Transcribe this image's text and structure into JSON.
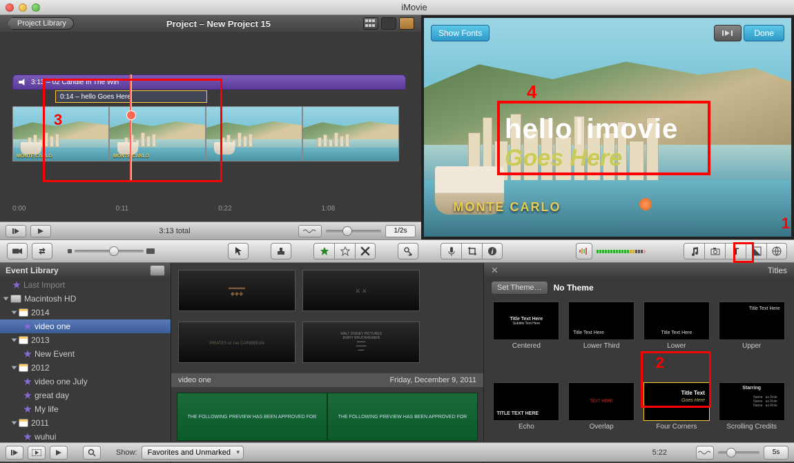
{
  "app_title": "iMovie",
  "project": {
    "back_label": "Project Library",
    "title": "Project – New Project 15",
    "audio_track_label": "3:13 – 02 Candle In The Win",
    "title_overlay": "0:14 – hello   Goes Here",
    "clip_label": "MONTE CARLO",
    "time_marks": [
      "0:00",
      "0:11",
      "0:22",
      "1:08"
    ],
    "total_label": "3:13 total",
    "zoom_label": "1/2s"
  },
  "preview": {
    "show_fonts": "Show Fonts",
    "done": "Done",
    "title_main_1": "hello",
    "title_main_2": "imovie",
    "title_sub": "Goes Here",
    "watermark": "MONTE CARLO"
  },
  "event_library": {
    "header": "Event Library",
    "items": [
      {
        "label": "Last Import",
        "indent": 1,
        "icon": "star",
        "dim": true
      },
      {
        "label": "Macintosh HD",
        "indent": 0,
        "icon": "hd",
        "disclosure": "open"
      },
      {
        "label": "2014",
        "indent": 1,
        "icon": "cal",
        "disclosure": "open"
      },
      {
        "label": "video one",
        "indent": 2,
        "icon": "star",
        "selected": true
      },
      {
        "label": "2013",
        "indent": 1,
        "icon": "cal",
        "disclosure": "open"
      },
      {
        "label": "New Event",
        "indent": 2,
        "icon": "star"
      },
      {
        "label": "2012",
        "indent": 1,
        "icon": "cal",
        "disclosure": "open"
      },
      {
        "label": "video one July",
        "indent": 2,
        "icon": "star"
      },
      {
        "label": "great day",
        "indent": 2,
        "icon": "star"
      },
      {
        "label": "My life",
        "indent": 2,
        "icon": "star"
      },
      {
        "label": "2011",
        "indent": 1,
        "icon": "cal",
        "disclosure": "open"
      },
      {
        "label": "wuhui",
        "indent": 2,
        "icon": "star"
      }
    ]
  },
  "event_browser": {
    "current_event": "video one",
    "date_label": "Friday, December 9, 2011",
    "preview_text": "THE FOLLOWING PREVIEW HAS BEEN APPROVED FOR"
  },
  "titles_panel": {
    "header": "Titles",
    "set_theme": "Set Theme…",
    "theme_name": "No Theme",
    "items": [
      {
        "label": "Centered",
        "line1": "Title Text Here",
        "line2": "Subtitle Text Here"
      },
      {
        "label": "Lower Third",
        "line1": "Title Text Here"
      },
      {
        "label": "Lower",
        "line1": "Title Text Here"
      },
      {
        "label": "Upper",
        "line1": "Title Text Here"
      },
      {
        "label": "Echo",
        "line1": "TITLE TEXT HERE"
      },
      {
        "label": "Overlap",
        "line1": "TEXT HERE"
      },
      {
        "label": "Four Corners",
        "line1": "Title Text",
        "line2": "Goes Here",
        "selected": true
      },
      {
        "label": "Scrolling Credits",
        "line1": "Starring"
      }
    ]
  },
  "bottom_bar": {
    "show_label": "Show:",
    "show_value": "Favorites and Unmarked",
    "duration": "5:22",
    "right_value": "5s"
  },
  "annotations": {
    "a1": "1",
    "a2": "2",
    "a3": "3",
    "a4": "4"
  }
}
